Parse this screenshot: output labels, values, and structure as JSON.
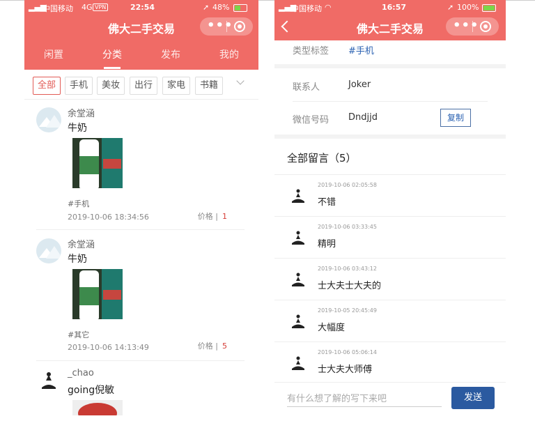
{
  "left": {
    "status": {
      "carrier": "中国移动",
      "network": "4G",
      "vpn": "VPN",
      "time": "22:54",
      "battery": "48%"
    },
    "nav": {
      "title": "佛大二手交易"
    },
    "tabs": [
      "闲置",
      "分类",
      "发布",
      "我的"
    ],
    "categories": [
      "全部",
      "手机",
      "美妆",
      "出行",
      "家电",
      "书籍"
    ],
    "posts": [
      {
        "user": "余堂涵",
        "title": "牛奶",
        "tag": "#手机",
        "date": "2019-10-06 18:34:56",
        "price_label": "价格 |",
        "price": "1"
      },
      {
        "user": "余堂涵",
        "title": "牛奶",
        "tag": "#其它",
        "date": "2019-10-06 14:13:49",
        "price_label": "价格 |",
        "price": "5"
      },
      {
        "user": "_chao",
        "title": "going倪敏"
      }
    ]
  },
  "right": {
    "status": {
      "carrier": "中国移动",
      "time": "16:57",
      "battery": "100%"
    },
    "nav": {
      "title": "佛大二手交易"
    },
    "info": {
      "tag_label": "类型标签",
      "tag_value": "#手机",
      "contact_label": "联系人",
      "contact_value": "Joker",
      "wechat_label": "微信号码",
      "wechat_value": "Dndjjd",
      "copy_label": "复制"
    },
    "comments_title": "全部留言（5）",
    "comments": [
      {
        "time": "2019-10-06 02:05:58",
        "text": "不错"
      },
      {
        "time": "2019-10-06 03:33:45",
        "text": "精明"
      },
      {
        "time": "2019-10-06 03:43:12",
        "text": "士大夫士大夫的"
      },
      {
        "time": "2019-10-05 20:45:49",
        "text": "大幅度"
      },
      {
        "time": "2019-10-06 05:06:14",
        "text": "士大夫大师傅"
      }
    ],
    "input_placeholder": "有什么想了解的写下来吧",
    "send_label": "发送"
  },
  "colors": {
    "brand": "#f06b66",
    "price": "#d53b35",
    "link": "#2b62b2",
    "send": "#2b5aa0"
  }
}
